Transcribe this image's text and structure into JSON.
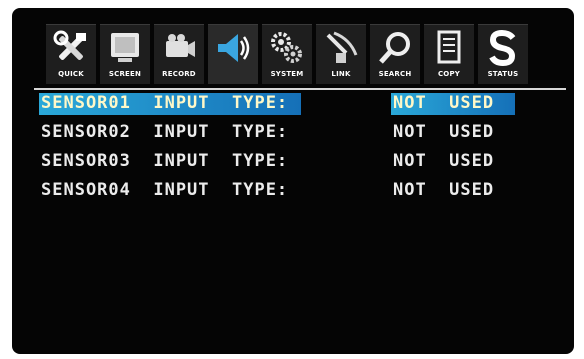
{
  "toolbar": {
    "tabs": [
      {
        "label": "QUICK",
        "icon": "tools-icon"
      },
      {
        "label": "SCREEN",
        "icon": "monitor-icon"
      },
      {
        "label": "RECORD",
        "icon": "camera-icon"
      },
      {
        "label": "",
        "icon": "speaker-icon"
      },
      {
        "label": "SYSTEM",
        "icon": "gears-icon"
      },
      {
        "label": "LINK",
        "icon": "satellite-icon"
      },
      {
        "label": "SEARCH",
        "icon": "magnifier-icon"
      },
      {
        "label": "COPY",
        "icon": "document-icon"
      },
      {
        "label": "STATUS",
        "icon": "status-s-icon"
      }
    ],
    "active_index": 3
  },
  "rows": [
    {
      "name": "SENSOR01  INPUT  TYPE:",
      "value": "NOT  USED",
      "selected": true
    },
    {
      "name": "SENSOR02  INPUT  TYPE:",
      "value": "NOT  USED",
      "selected": false
    },
    {
      "name": "SENSOR03  INPUT  TYPE:",
      "value": "NOT  USED",
      "selected": false
    },
    {
      "name": "SENSOR04  INPUT  TYPE:",
      "value": "NOT  USED",
      "selected": false
    }
  ],
  "colors": {
    "background": "#050505",
    "highlight_start": "#2aa8d8",
    "highlight_end": "#1570b8",
    "text": "#ececec"
  }
}
